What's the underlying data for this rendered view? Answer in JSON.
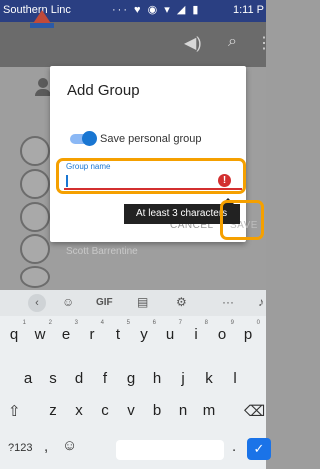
{
  "status_bar": {
    "carrier": "Southern Linc",
    "mid": "··· ♥ ◉ ▾ ◢ ▮",
    "time": "1:11 P"
  },
  "list": {
    "row_name": "Scott Barrentine"
  },
  "dialog": {
    "title": "Add Group",
    "switch_label": "Save personal group",
    "field_label": "Group name",
    "field_value": "",
    "error_tooltip": "At least 3 characters",
    "cancel_label": "CANCEL",
    "save_label": "SAVE"
  },
  "keyboard": {
    "top_row": [
      "GIF"
    ],
    "row1": [
      {
        "k": "q",
        "h": "1"
      },
      {
        "k": "w",
        "h": "2"
      },
      {
        "k": "e",
        "h": "3"
      },
      {
        "k": "r",
        "h": "4"
      },
      {
        "k": "t",
        "h": "5"
      },
      {
        "k": "y",
        "h": "6"
      },
      {
        "k": "u",
        "h": "7"
      },
      {
        "k": "i",
        "h": "8"
      },
      {
        "k": "o",
        "h": "9"
      },
      {
        "k": "p",
        "h": "0"
      }
    ],
    "row2": [
      "a",
      "s",
      "d",
      "f",
      "g",
      "h",
      "j",
      "k",
      "l"
    ],
    "row3": [
      "z",
      "x",
      "c",
      "v",
      "b",
      "n",
      "m"
    ],
    "bottom": {
      "numbers": "?123",
      "comma": ",",
      "period": "."
    }
  },
  "colors": {
    "accent": "#1976d2",
    "error": "#d32f2f",
    "highlight": "#f5a000",
    "status_bar": "#2a3f82"
  }
}
